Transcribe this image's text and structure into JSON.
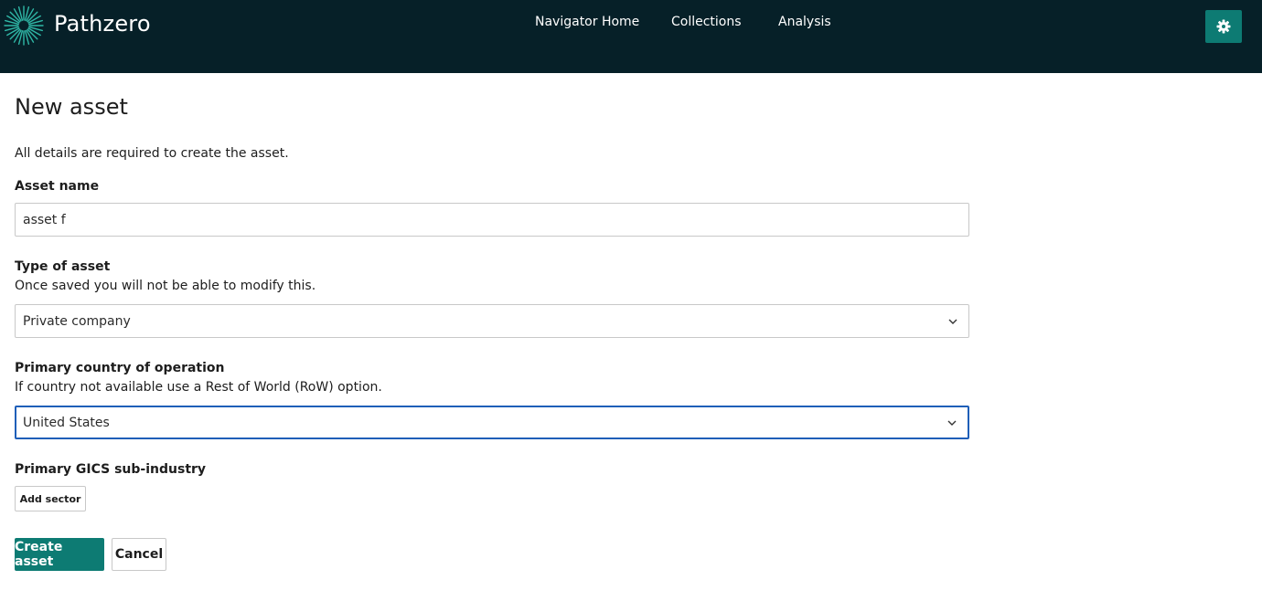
{
  "header": {
    "brand": "Pathzero",
    "nav": [
      {
        "label": "Navigator Home"
      },
      {
        "label": "Collections"
      },
      {
        "label": "Analysis"
      }
    ],
    "settings_icon": "gear-icon"
  },
  "colors": {
    "header_bg": "#062028",
    "accent": "#0d7b73",
    "focus": "#1f5fb8"
  },
  "page": {
    "title": "New asset",
    "intro": "All details are required to create the asset."
  },
  "form": {
    "asset_name": {
      "label": "Asset name",
      "value": "asset f"
    },
    "asset_type": {
      "label": "Type of asset",
      "hint": "Once saved you will not be able to modify this.",
      "selected": "Private company"
    },
    "country": {
      "label": "Primary country of operation",
      "hint": "If country not available use a Rest of World (RoW) option.",
      "selected": "United States"
    },
    "gics": {
      "label": "Primary GICS sub-industry",
      "add_label": "Add sector"
    },
    "actions": {
      "create_label": "Create asset",
      "cancel_label": "Cancel"
    }
  }
}
